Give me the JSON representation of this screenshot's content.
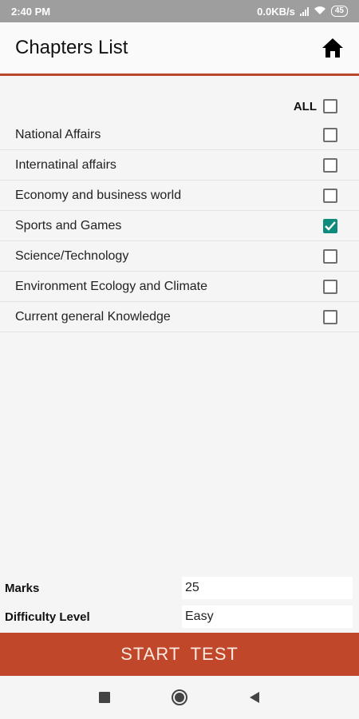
{
  "status_bar": {
    "time": "2:40 PM",
    "speed": "0.0KB/s",
    "battery": "45"
  },
  "app_bar": {
    "title": "Chapters List",
    "home_icon": "home-icon"
  },
  "select_all": {
    "label": "ALL",
    "checked": false
  },
  "chapters": [
    {
      "name": "National Affairs",
      "checked": false
    },
    {
      "name": "Internatinal affairs",
      "checked": false
    },
    {
      "name": "Economy and business world",
      "checked": false
    },
    {
      "name": "Sports and Games",
      "checked": true
    },
    {
      "name": "Science/Technology",
      "checked": false
    },
    {
      "name": "Environment Ecology and Climate",
      "checked": false
    },
    {
      "name": "Current general Knowledge",
      "checked": false
    }
  ],
  "settings": {
    "marks_label": "Marks",
    "marks_value": "25",
    "difficulty_label": "Difficulty Level",
    "difficulty_value": "Easy"
  },
  "start_button": {
    "label": "START TEST"
  },
  "colors": {
    "accent": "#c1472a",
    "check": "#0f8b7d"
  },
  "nav": [
    "square-icon",
    "circle-icon",
    "back-triangle-icon"
  ]
}
